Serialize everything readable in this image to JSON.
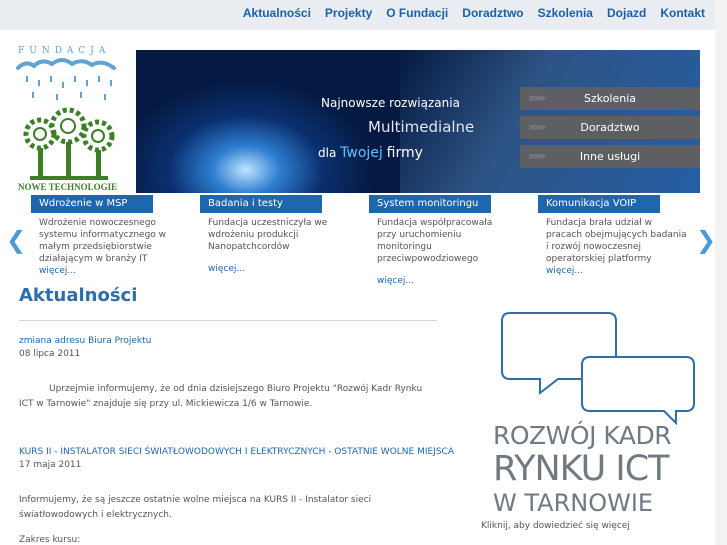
{
  "nav": {
    "items": [
      "Aktualności",
      "Projekty",
      "O Fundacji",
      "Doradztwo",
      "Szkolenia",
      "Dojazd",
      "Kontakt"
    ]
  },
  "logo": {
    "top_text": "FUNDACJA",
    "bottom_text": "NOWE TECHNOLOGIE"
  },
  "banner": {
    "line1": "Najnowsze rozwiązania",
    "line2": "Multimedialne",
    "line3_prefix": "dla",
    "line3_word1": "Twojej",
    "line3_word2": "firmy",
    "buttons": [
      "Szkolenia",
      "Doradztwo",
      "Inne usługi"
    ]
  },
  "carousel": {
    "prev_arrow": "❮",
    "next_arrow": "❯",
    "tiles": [
      {
        "title": "Wdrożenie w MSP",
        "text": "Wdrożenie nowoczesnego systemu informatycznego w małym przedsiębiorstwie działającym w branży IT",
        "more": "więcej..."
      },
      {
        "title": "Badania i testy",
        "text": "Fundacja uczestniczyła we wdrożeniu produkcji Nanopatchcordów",
        "more": "więcej..."
      },
      {
        "title": "System monitoringu",
        "text": "Fundacja współpracowała przy uruchomieniu monitoringu przeciwpowodziowego",
        "more": "więcej..."
      },
      {
        "title": "Komunikacja VOIP",
        "text": "Fundacja brała udział w pracach obejmujących badania i rozwój nowoczesnej operatorskiej platformy",
        "more": "więcej..."
      }
    ]
  },
  "main": {
    "title": "Aktualności",
    "news": [
      {
        "title": "zmiana adresu Biura Projektu",
        "date": "08 lipca 2011",
        "text": "Uprzejmie informujemy, że od dnia dzisiejszego Biuro Projektu \"Rozwój Kadr Rynku ICT w Tarnowie\"  znajduje się przy ul. Mickiewicza 1/6 w Tarnowie."
      },
      {
        "title": "KURS II - INSTALATOR SIECI ŚWIATŁOWODOWYCH I ELEKTRYCZNYCH - OSTATNIE WOLNE MIEJSCA",
        "date": "17 maja 2011",
        "text": "Informujemy, że są jeszcze ostatnie wolne miejsca na KURS II -  Instalator sieci światłowodowych i elektrycznych.",
        "extra": "Zakres kursu:"
      }
    ]
  },
  "promo": {
    "line1": "ROZWÓJ KADR",
    "line2": "RYNKU ICT",
    "line3": "W TARNOWIE",
    "caption": "Kliknij, aby dowiedzieć się więcej"
  },
  "colors": {
    "accent": "#1e66ad",
    "nav_bg": "#e9edf2",
    "logo_green": "#3d7f27",
    "logo_blue": "#5ea3d2",
    "banner_button": "#5d5f63"
  }
}
